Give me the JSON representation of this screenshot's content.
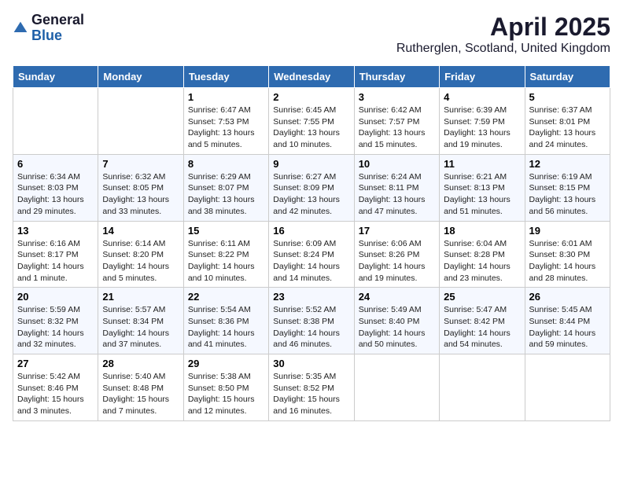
{
  "logo": {
    "general": "General",
    "blue": "Blue"
  },
  "title": "April 2025",
  "subtitle": "Rutherglen, Scotland, United Kingdom",
  "days": [
    "Sunday",
    "Monday",
    "Tuesday",
    "Wednesday",
    "Thursday",
    "Friday",
    "Saturday"
  ],
  "weeks": [
    [
      {
        "date": "",
        "info": ""
      },
      {
        "date": "",
        "info": ""
      },
      {
        "date": "1",
        "info": "Sunrise: 6:47 AM\nSunset: 7:53 PM\nDaylight: 13 hours and 5 minutes."
      },
      {
        "date": "2",
        "info": "Sunrise: 6:45 AM\nSunset: 7:55 PM\nDaylight: 13 hours and 10 minutes."
      },
      {
        "date": "3",
        "info": "Sunrise: 6:42 AM\nSunset: 7:57 PM\nDaylight: 13 hours and 15 minutes."
      },
      {
        "date": "4",
        "info": "Sunrise: 6:39 AM\nSunset: 7:59 PM\nDaylight: 13 hours and 19 minutes."
      },
      {
        "date": "5",
        "info": "Sunrise: 6:37 AM\nSunset: 8:01 PM\nDaylight: 13 hours and 24 minutes."
      }
    ],
    [
      {
        "date": "6",
        "info": "Sunrise: 6:34 AM\nSunset: 8:03 PM\nDaylight: 13 hours and 29 minutes."
      },
      {
        "date": "7",
        "info": "Sunrise: 6:32 AM\nSunset: 8:05 PM\nDaylight: 13 hours and 33 minutes."
      },
      {
        "date": "8",
        "info": "Sunrise: 6:29 AM\nSunset: 8:07 PM\nDaylight: 13 hours and 38 minutes."
      },
      {
        "date": "9",
        "info": "Sunrise: 6:27 AM\nSunset: 8:09 PM\nDaylight: 13 hours and 42 minutes."
      },
      {
        "date": "10",
        "info": "Sunrise: 6:24 AM\nSunset: 8:11 PM\nDaylight: 13 hours and 47 minutes."
      },
      {
        "date": "11",
        "info": "Sunrise: 6:21 AM\nSunset: 8:13 PM\nDaylight: 13 hours and 51 minutes."
      },
      {
        "date": "12",
        "info": "Sunrise: 6:19 AM\nSunset: 8:15 PM\nDaylight: 13 hours and 56 minutes."
      }
    ],
    [
      {
        "date": "13",
        "info": "Sunrise: 6:16 AM\nSunset: 8:17 PM\nDaylight: 14 hours and 1 minute."
      },
      {
        "date": "14",
        "info": "Sunrise: 6:14 AM\nSunset: 8:20 PM\nDaylight: 14 hours and 5 minutes."
      },
      {
        "date": "15",
        "info": "Sunrise: 6:11 AM\nSunset: 8:22 PM\nDaylight: 14 hours and 10 minutes."
      },
      {
        "date": "16",
        "info": "Sunrise: 6:09 AM\nSunset: 8:24 PM\nDaylight: 14 hours and 14 minutes."
      },
      {
        "date": "17",
        "info": "Sunrise: 6:06 AM\nSunset: 8:26 PM\nDaylight: 14 hours and 19 minutes."
      },
      {
        "date": "18",
        "info": "Sunrise: 6:04 AM\nSunset: 8:28 PM\nDaylight: 14 hours and 23 minutes."
      },
      {
        "date": "19",
        "info": "Sunrise: 6:01 AM\nSunset: 8:30 PM\nDaylight: 14 hours and 28 minutes."
      }
    ],
    [
      {
        "date": "20",
        "info": "Sunrise: 5:59 AM\nSunset: 8:32 PM\nDaylight: 14 hours and 32 minutes."
      },
      {
        "date": "21",
        "info": "Sunrise: 5:57 AM\nSunset: 8:34 PM\nDaylight: 14 hours and 37 minutes."
      },
      {
        "date": "22",
        "info": "Sunrise: 5:54 AM\nSunset: 8:36 PM\nDaylight: 14 hours and 41 minutes."
      },
      {
        "date": "23",
        "info": "Sunrise: 5:52 AM\nSunset: 8:38 PM\nDaylight: 14 hours and 46 minutes."
      },
      {
        "date": "24",
        "info": "Sunrise: 5:49 AM\nSunset: 8:40 PM\nDaylight: 14 hours and 50 minutes."
      },
      {
        "date": "25",
        "info": "Sunrise: 5:47 AM\nSunset: 8:42 PM\nDaylight: 14 hours and 54 minutes."
      },
      {
        "date": "26",
        "info": "Sunrise: 5:45 AM\nSunset: 8:44 PM\nDaylight: 14 hours and 59 minutes."
      }
    ],
    [
      {
        "date": "27",
        "info": "Sunrise: 5:42 AM\nSunset: 8:46 PM\nDaylight: 15 hours and 3 minutes."
      },
      {
        "date": "28",
        "info": "Sunrise: 5:40 AM\nSunset: 8:48 PM\nDaylight: 15 hours and 7 minutes."
      },
      {
        "date": "29",
        "info": "Sunrise: 5:38 AM\nSunset: 8:50 PM\nDaylight: 15 hours and 12 minutes."
      },
      {
        "date": "30",
        "info": "Sunrise: 5:35 AM\nSunset: 8:52 PM\nDaylight: 15 hours and 16 minutes."
      },
      {
        "date": "",
        "info": ""
      },
      {
        "date": "",
        "info": ""
      },
      {
        "date": "",
        "info": ""
      }
    ]
  ]
}
